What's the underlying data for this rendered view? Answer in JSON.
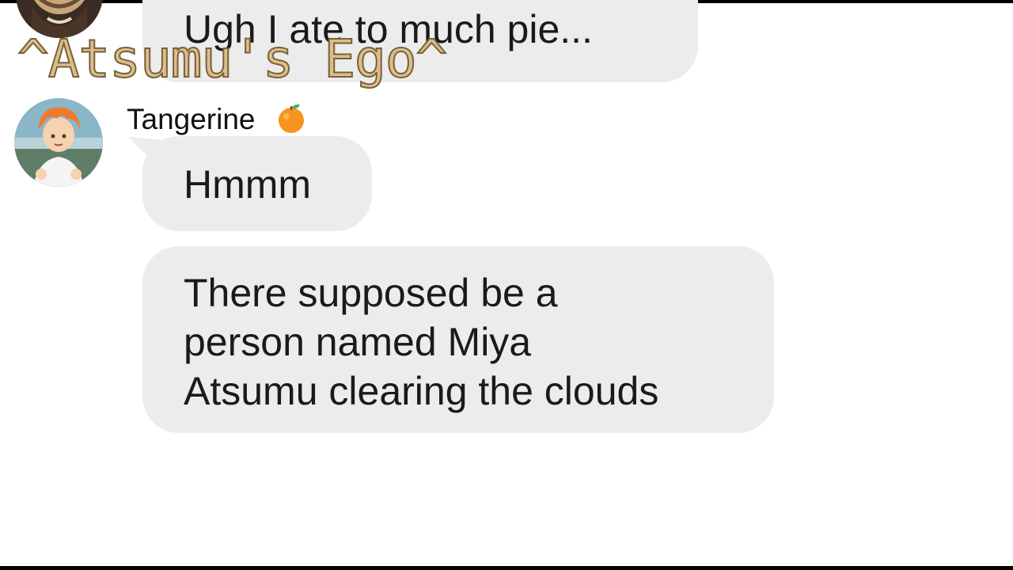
{
  "watermark": "^Atsumu's Ego^",
  "chat": {
    "messages": [
      {
        "text": "Ugh I ate to much pie..."
      },
      {
        "sender": "Tangerine",
        "sender_emoji": "orange-icon",
        "text": "Hmmm"
      },
      {
        "lines": [
          "There supposed be a",
          "person named Miya",
          "Atsumu clearing the clouds"
        ]
      }
    ]
  },
  "colors": {
    "bubble": "#ececec",
    "text": "#1a1a1a",
    "watermark_fill": "#d9c08a",
    "watermark_stroke": "#7a5f3a"
  }
}
